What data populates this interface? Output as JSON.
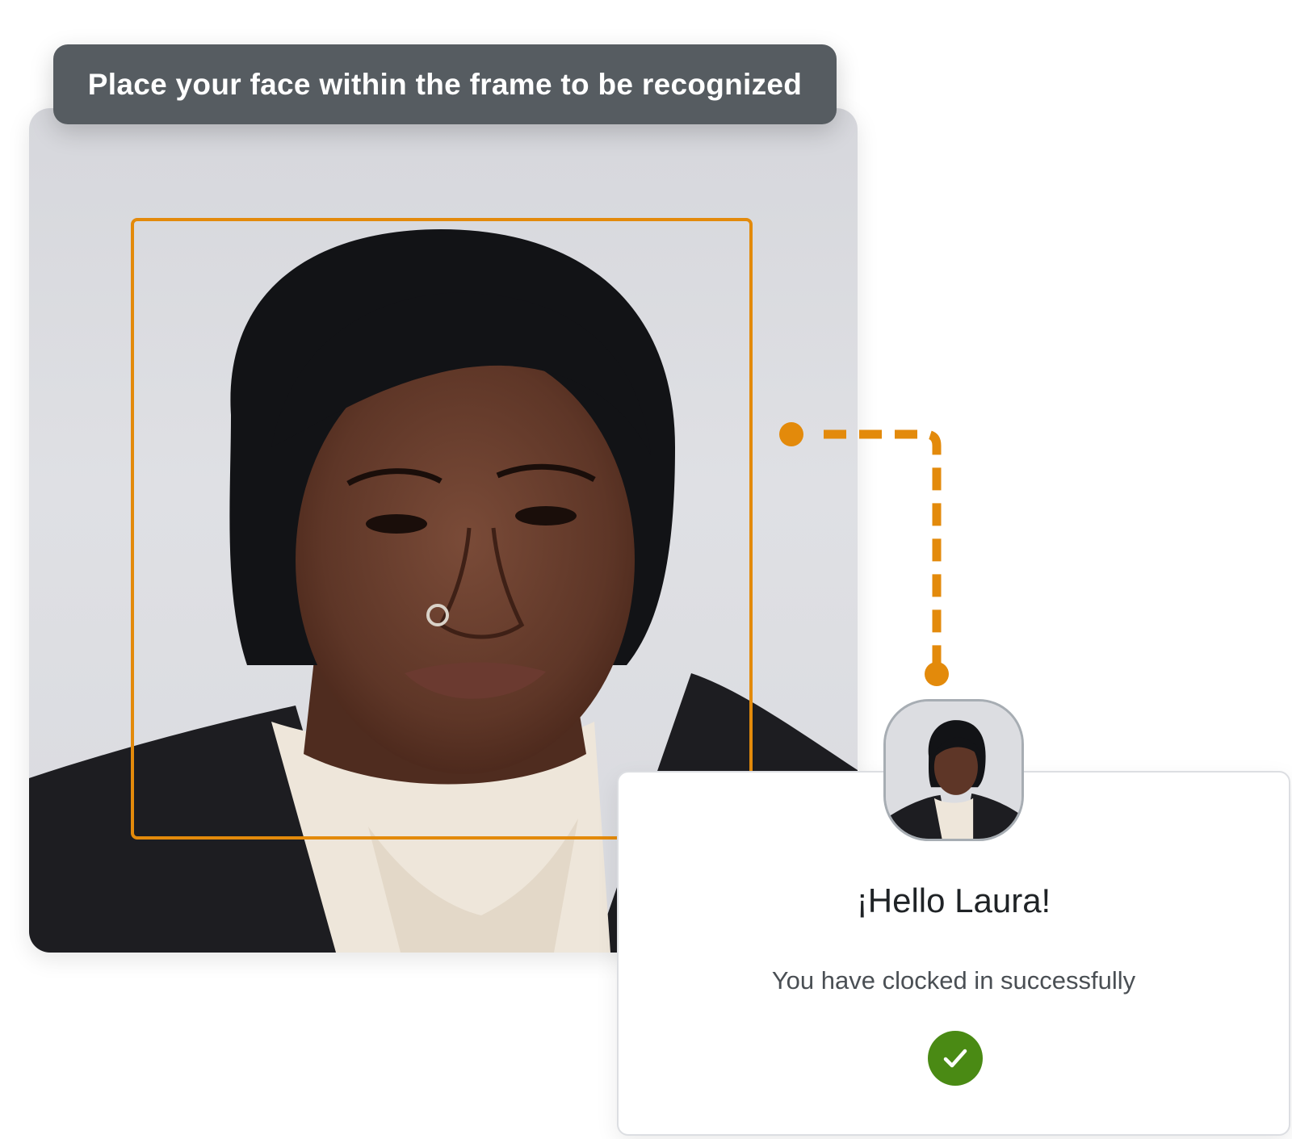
{
  "banner": {
    "text": "Place your face within the frame to be recognized"
  },
  "result": {
    "greeting": "¡Hello Laura!",
    "status": "You have clocked in successfully",
    "status_icon": "check-icon"
  },
  "colors": {
    "accent": "#e38a0b",
    "banner_bg": "#565c61",
    "success": "#4a8a14"
  }
}
